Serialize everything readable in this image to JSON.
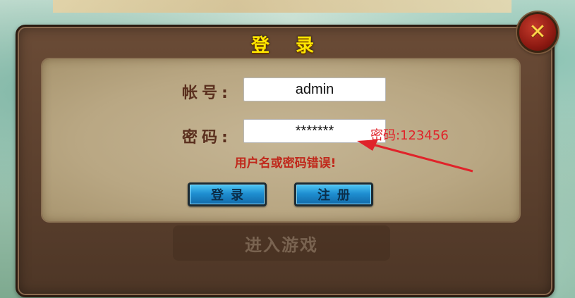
{
  "dialog": {
    "title": "登 录",
    "close_icon": "close-icon",
    "account_label": "帐号:",
    "account_value": "admin",
    "password_label": "密码:",
    "password_value": "*******",
    "error_text": "用户名或密码错误!",
    "login_button": "登录",
    "register_button": "注册",
    "enter_game_button": "进入游戏"
  },
  "annotation": {
    "text": "密码:123456",
    "color": "#e0232a"
  }
}
